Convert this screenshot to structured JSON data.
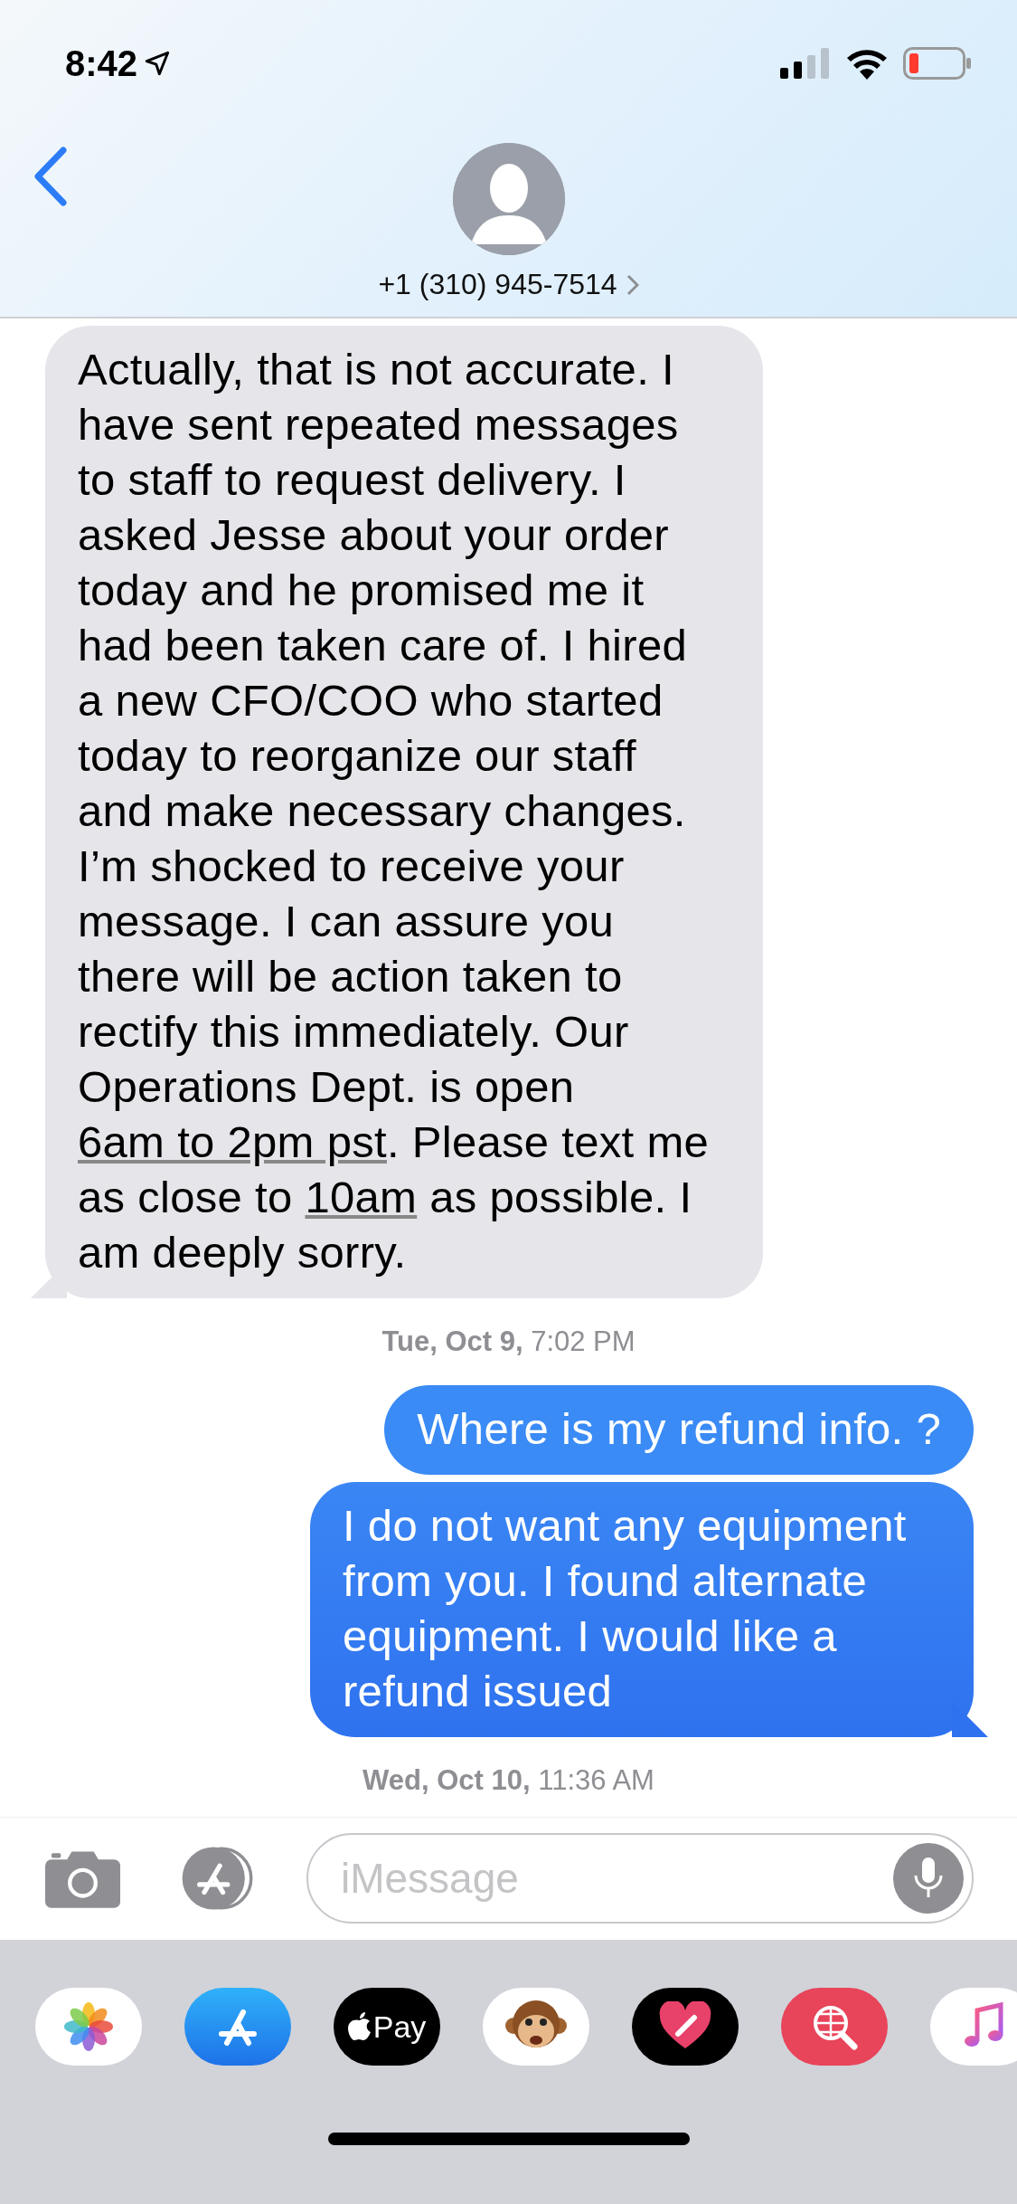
{
  "status_bar": {
    "time": "8:42"
  },
  "contact": {
    "phone": "+1 (310) 945-7514"
  },
  "messages": [
    {
      "kind": "incoming",
      "tail": true,
      "segments": [
        {
          "text": "Actually, that is not accurate. I have sent repeated messages to staff to request delivery. I asked Jesse about your order today and he promised me it had been taken care of. I hired a new CFO/COO who started today to reorganize our staff and make necessary changes. I’m shocked to receive your message. I can assure you there will be action taken to rectify this immediately. Our Operations Dept. is open ",
          "link": false
        },
        {
          "text": "6am to 2pm pst",
          "link": true
        },
        {
          "text": ". Please text me as close to ",
          "link": false
        },
        {
          "text": "10am",
          "link": true
        },
        {
          "text": " as possible. I am deeply sorry.",
          "link": false
        }
      ]
    },
    {
      "kind": "timestamp",
      "text": "**Tue, Oct 9,** 7:02 PM"
    },
    {
      "kind": "outgoing",
      "tail": false,
      "segments": [
        {
          "text": "Where is my refund info. ?",
          "link": false
        }
      ]
    },
    {
      "kind": "outgoing",
      "tail": true,
      "segments": [
        {
          "text": "I do not want any equipment from you. I found alternate equipment. I would like a refund issued",
          "link": false
        }
      ]
    },
    {
      "kind": "timestamp",
      "text": "**Wed, Oct 10,** 11:36 AM"
    }
  ],
  "composer": {
    "placeholder": "iMessage"
  },
  "apps": [
    {
      "kind": "photos"
    },
    {
      "kind": "appstore"
    },
    {
      "kind": "pay",
      "label": "Pay"
    },
    {
      "kind": "animoji"
    },
    {
      "kind": "heart"
    },
    {
      "kind": "search"
    },
    {
      "kind": "music"
    }
  ]
}
